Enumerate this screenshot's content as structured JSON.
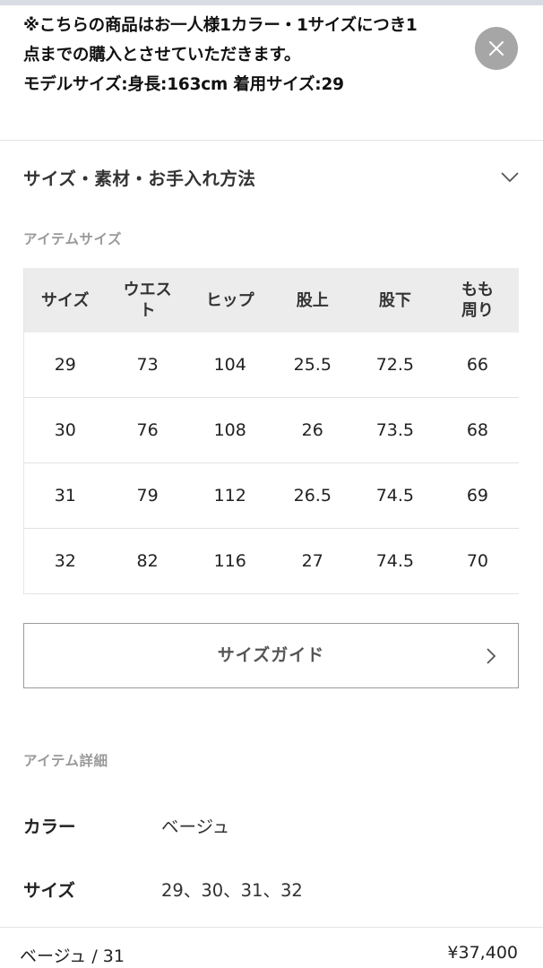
{
  "notice": {
    "line1": "※こちらの商品はお一人様1カラー・1サイズにつき1",
    "line2": "点までの購入とさせていただきます。",
    "line3": "モデルサイズ:身長:163cm 着用サイズ:29"
  },
  "close_icon": "close-icon",
  "accordion": {
    "title": "サイズ・素材・お手入れ方法",
    "icon": "chevron-down-icon"
  },
  "item_size": {
    "label": "アイテムサイズ",
    "headers": [
      [
        "サイズ"
      ],
      [
        "ウエス",
        "ト"
      ],
      [
        "ヒップ"
      ],
      [
        "股上"
      ],
      [
        "股下"
      ],
      [
        "もも",
        "周り"
      ]
    ],
    "rows": [
      [
        "29",
        "73",
        "104",
        "25.5",
        "72.5",
        "66"
      ],
      [
        "30",
        "76",
        "108",
        "26",
        "73.5",
        "68"
      ],
      [
        "31",
        "79",
        "112",
        "26.5",
        "74.5",
        "69"
      ],
      [
        "32",
        "82",
        "116",
        "27",
        "74.5",
        "70"
      ]
    ]
  },
  "size_guide": {
    "label": "サイズガイド",
    "icon": "chevron-right-icon"
  },
  "item_details": {
    "label": "アイテム詳細",
    "color_key": "カラー",
    "color_value": "ベージュ",
    "size_key": "サイズ",
    "size_value": "29、30、31、32"
  },
  "footer": {
    "selection": "ベージュ / 31",
    "price": "¥37,400"
  }
}
